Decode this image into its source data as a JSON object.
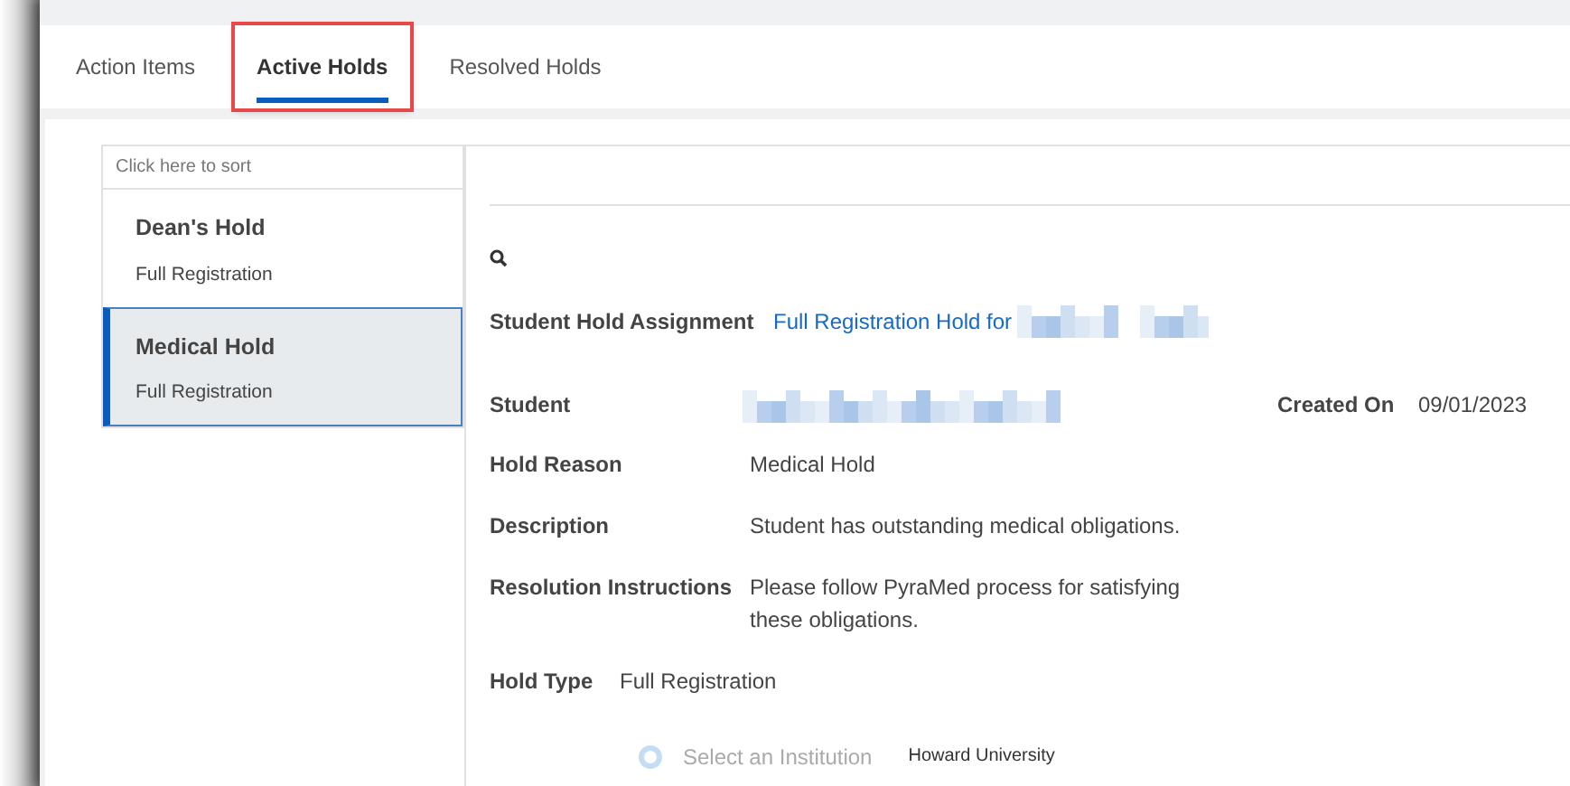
{
  "tabs": [
    {
      "label": "Action Items",
      "selected": false,
      "highlighted": false
    },
    {
      "label": "Active Holds",
      "selected": true,
      "highlighted": true
    },
    {
      "label": "Resolved Holds",
      "selected": false,
      "highlighted": false
    }
  ],
  "holds_list": {
    "sort_hint": "Click here to sort",
    "items": [
      {
        "title": "Dean's Hold",
        "subtitle": "Full Registration",
        "selected": false
      },
      {
        "title": "Medical Hold",
        "subtitle": "Full Registration",
        "selected": true
      }
    ]
  },
  "details": {
    "assignment": {
      "label": "Student Hold Assignment",
      "link": "Full Registration Hold for"
    },
    "student": {
      "label": "Student",
      "created_label": "Created On",
      "created_value": "09/01/2023"
    },
    "fields": [
      {
        "label": "Hold Reason",
        "value": "Medical Hold"
      },
      {
        "label": "Description",
        "value": "Student has outstanding medical obligations."
      },
      {
        "label": "Resolution Instructions",
        "value": "Please follow PyraMed process for satisfying these obligations."
      }
    ],
    "hold_type": {
      "label": "Hold Type",
      "value": "Full Registration"
    },
    "institution": {
      "placeholder": "Select an Institution",
      "value": "Howard University"
    }
  }
}
